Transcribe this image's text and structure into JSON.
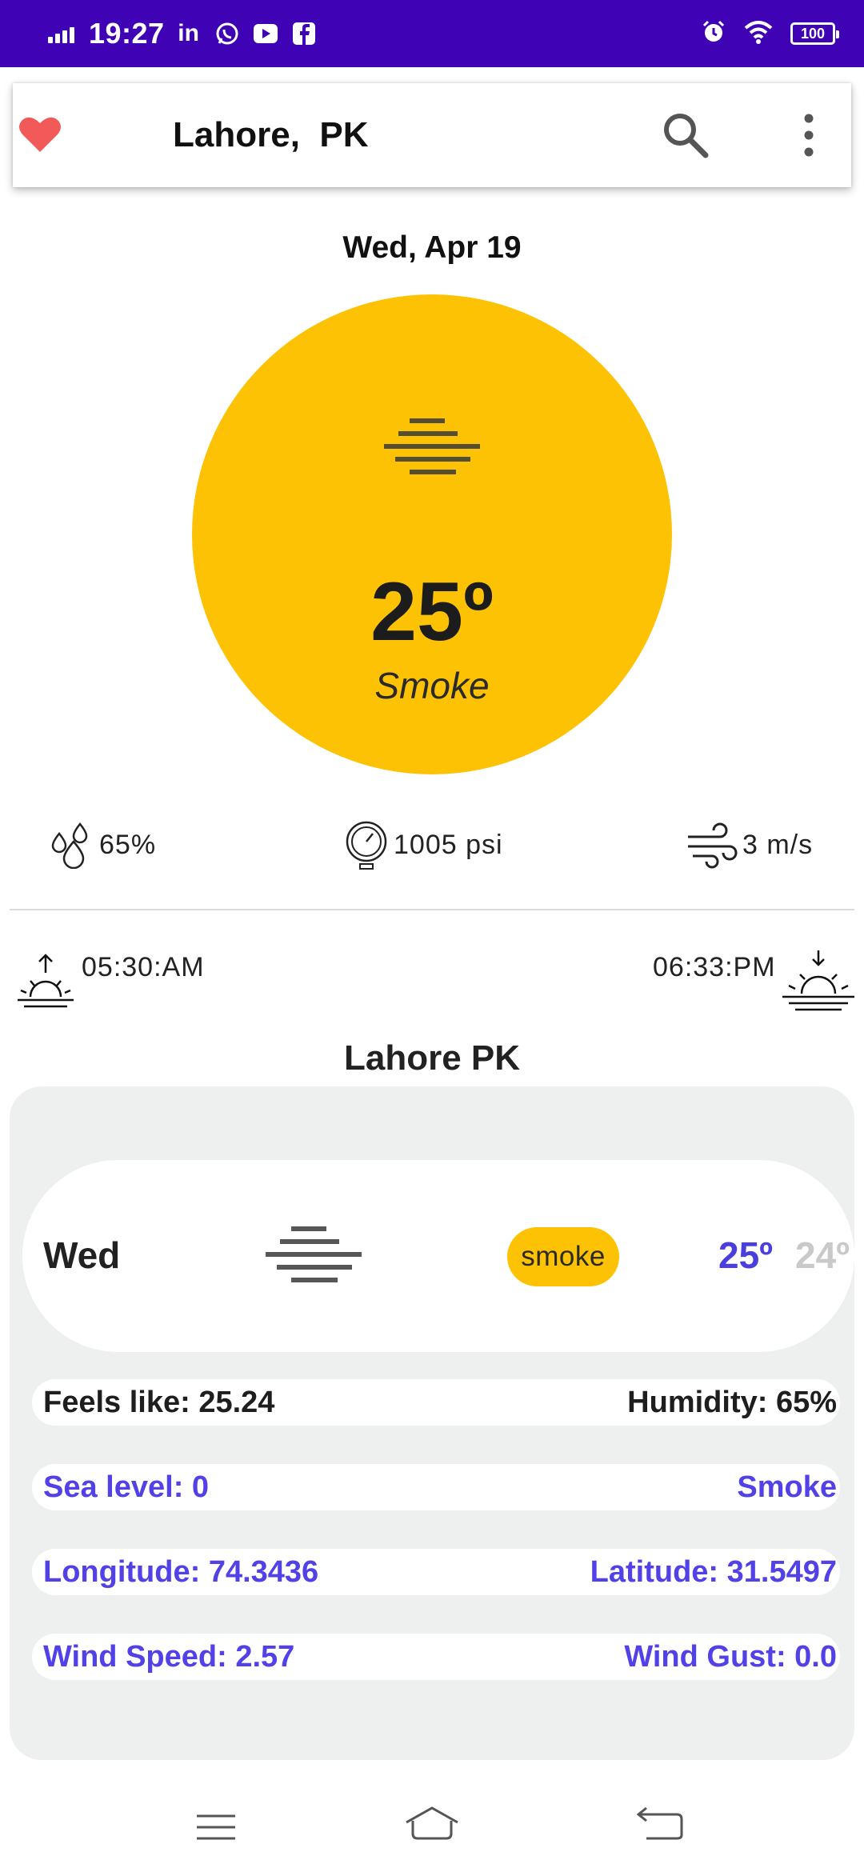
{
  "status_bar": {
    "time": "19:27",
    "battery": "100",
    "app_icons": [
      "in",
      "whatsapp-icon",
      "youtube-icon",
      "facebook-icon"
    ],
    "background": "#3f02b5"
  },
  "app_bar": {
    "city": "Lahore,  PK"
  },
  "current": {
    "date": "Wed, Apr 19",
    "temperature": "25º",
    "description": "Smoke",
    "circle_color": "#fcc203"
  },
  "stats": {
    "humidity": "65%",
    "pressure": "1005 psi",
    "wind": "3 m/s"
  },
  "sun": {
    "sunrise": "05:30:AM",
    "sunset": "06:33:PM"
  },
  "location_title": "Lahore PK",
  "forecast": {
    "day": "Wed",
    "condition": "smoke",
    "high": "25º",
    "low": "24º"
  },
  "details": {
    "feels_like": "Feels like: 25.24",
    "humidity": "Humidity: 65%",
    "sea_level": "Sea level: 0",
    "weather": "Smoke",
    "longitude": "Longitude: 74.3436",
    "latitude": "Latitude: 31.5497",
    "wind_speed": "Wind Speed: 2.57",
    "wind_gust": "Wind Gust: 0.0"
  },
  "colors": {
    "accent_blue": "#5241e6",
    "heart": "#f25a5a",
    "card_bg": "#eeefef"
  }
}
